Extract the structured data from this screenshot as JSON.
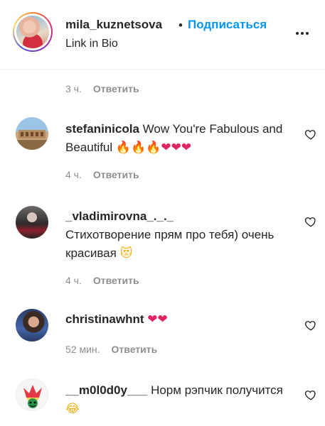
{
  "header": {
    "username": "mila_kuznetsova",
    "dot": "•",
    "follow_label": "Подписаться",
    "bio": "Link in Bio"
  },
  "top_meta": {
    "time": "3 ч.",
    "reply": "Ответить"
  },
  "comments": [
    {
      "username": "stefaninicola",
      "text": "Wow You're Fabulous and Beautiful",
      "emoji": "🔥🔥🔥❤❤❤",
      "time": "4 ч.",
      "reply": "Ответить"
    },
    {
      "username": "_vladimirovna_._._",
      "text": "Стихотворение прям про тебя) очень красивая",
      "emoji": "😻",
      "time": "4 ч.",
      "reply": "Ответить"
    },
    {
      "username": "christinawhnt",
      "text": "",
      "emoji": "❤❤",
      "time": "52 мин.",
      "reply": "Ответить"
    },
    {
      "username": "__m0l0d0y___",
      "text": "Норм рэпчик получится",
      "emoji": "😂",
      "time": "",
      "reply": ""
    }
  ],
  "icons": {
    "more": "more-options-icon",
    "heart": "heart-outline-icon"
  },
  "colors": {
    "accent": "#0095f6",
    "text": "#262626",
    "muted": "#8e8e8e",
    "divider": "#efefef"
  }
}
